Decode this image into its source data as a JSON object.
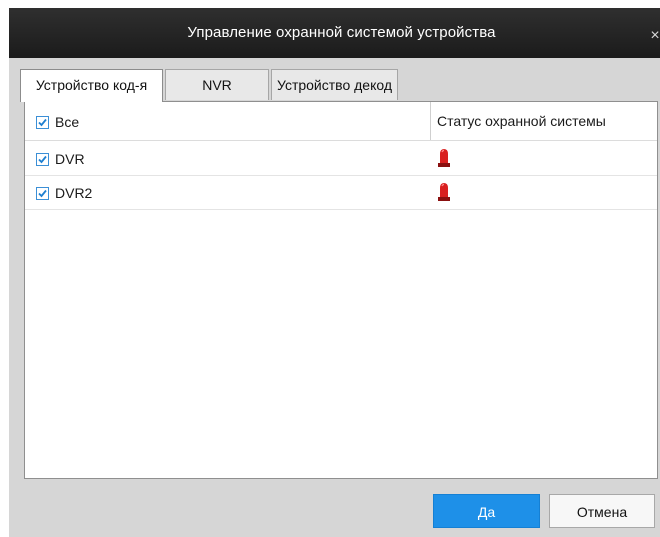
{
  "window": {
    "title": "Управление охранной системой устройства",
    "close_glyph": "×"
  },
  "tabs": [
    {
      "label": "Устройство код-я",
      "active": true
    },
    {
      "label": "NVR",
      "active": false
    },
    {
      "label": "Устройство декод",
      "active": false
    }
  ],
  "table": {
    "select_all": {
      "label": "Все",
      "checked": true
    },
    "status_header": "Статус охранной системы",
    "rows": [
      {
        "name": "DVR",
        "checked": true,
        "status_icon": "alarm-siren-icon"
      },
      {
        "name": "DVR2",
        "checked": true,
        "status_icon": "alarm-siren-icon"
      }
    ]
  },
  "buttons": {
    "ok": "Да",
    "cancel": "Отмена"
  },
  "colors": {
    "accent": "#1e90e8",
    "titlebar": "#222222",
    "alarm": "#d92020"
  }
}
